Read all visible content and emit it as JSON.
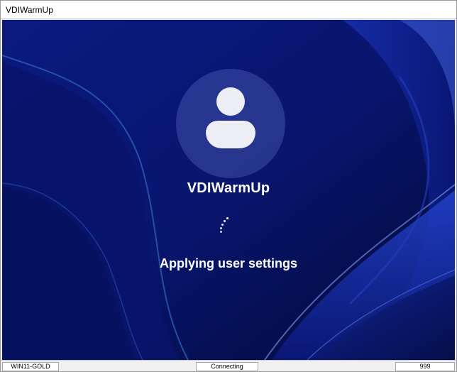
{
  "window": {
    "title": "VDIWarmUp"
  },
  "lockscreen": {
    "username": "VDIWarmUp",
    "message": "Applying user settings",
    "avatar_icon": "user-silhouette-icon",
    "spinner_icon": "loading-spinner-icon"
  },
  "statusbar": {
    "host": "WIN11-GOLD",
    "state": "Connecting",
    "value": "999"
  },
  "colors": {
    "wallpaper_dark": "#06124f",
    "wallpaper_mid": "#1a2fb5",
    "wallpaper_light": "#5b7cff",
    "text": "#ffffff"
  }
}
